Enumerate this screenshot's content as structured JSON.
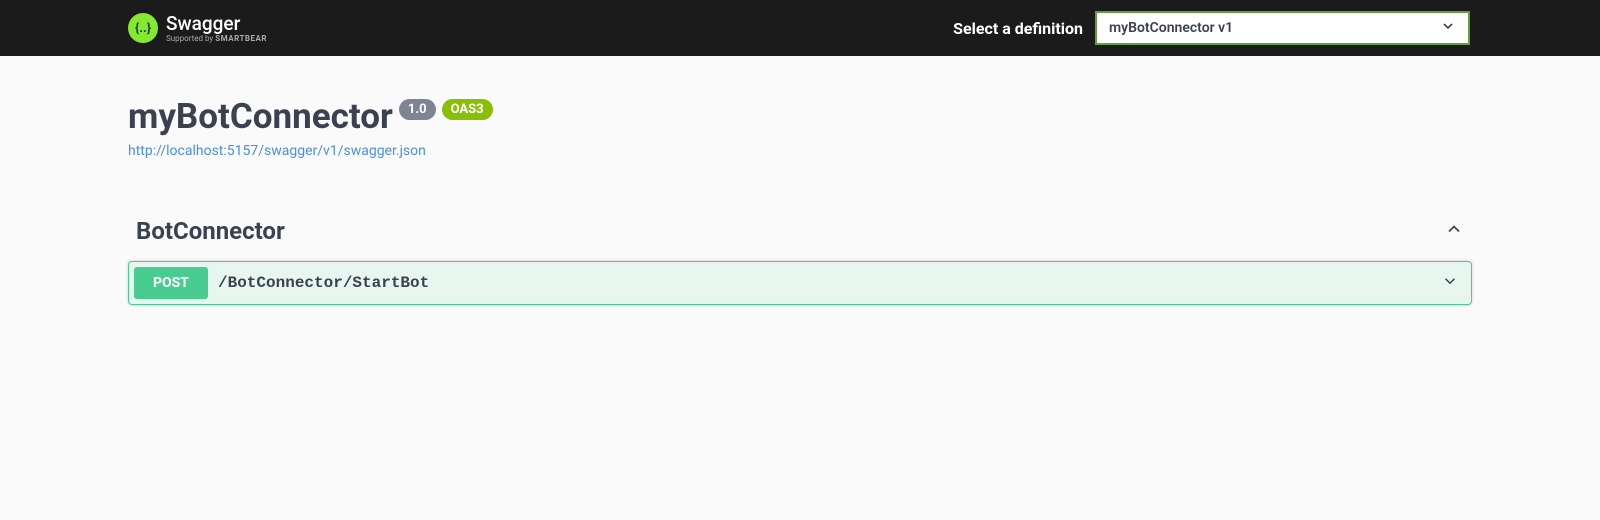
{
  "topbar": {
    "logo_text": "Swagger",
    "supported_prefix": "Supported by ",
    "supported_brand": "SMARTBEAR",
    "select_label": "Select a definition",
    "selected_definition": "myBotConnector v1"
  },
  "info": {
    "title": "myBotConnector",
    "version": "1.0",
    "oas_badge": "OAS3",
    "spec_url": "http://localhost:5157/swagger/v1/swagger.json"
  },
  "tags": [
    {
      "name": "BotConnector",
      "operations": [
        {
          "method": "POST",
          "path": "/BotConnector/StartBot"
        }
      ]
    }
  ]
}
